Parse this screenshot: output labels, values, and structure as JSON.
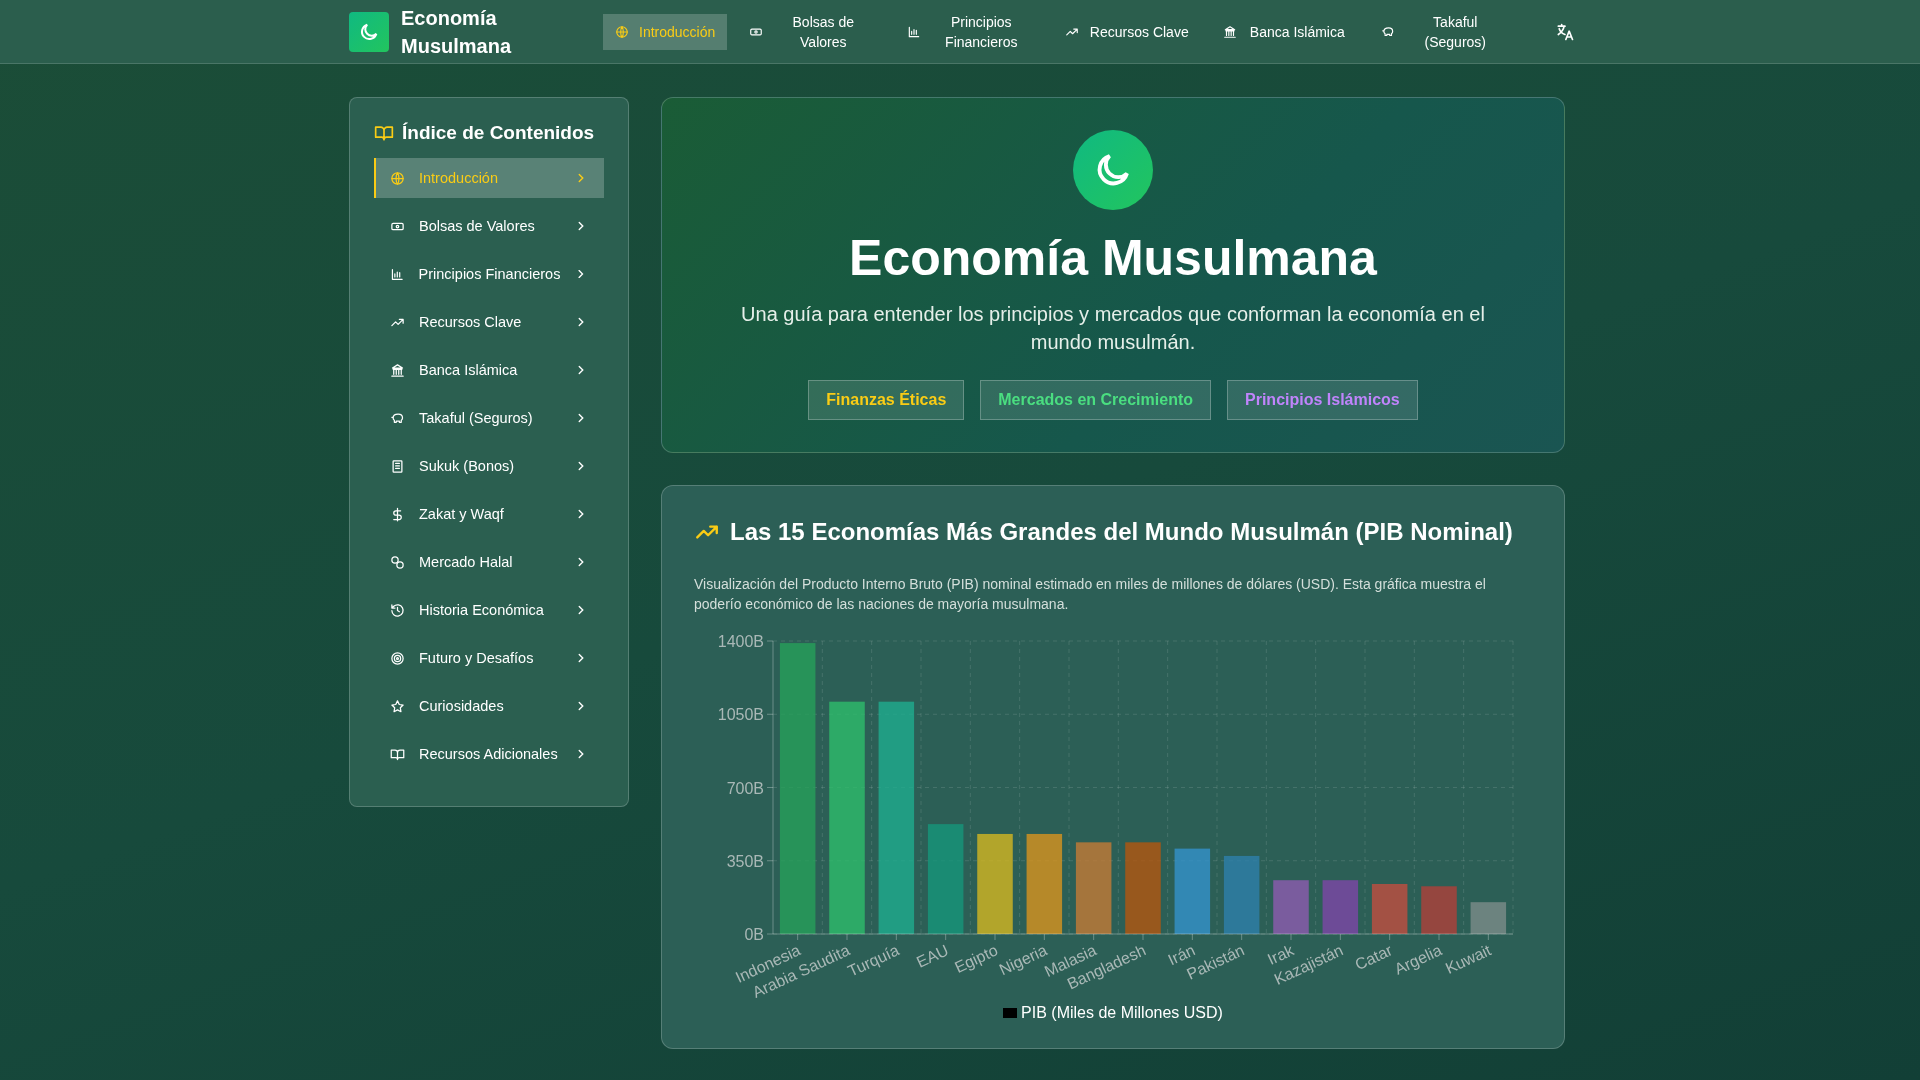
{
  "header": {
    "title": "Economía Musulmana",
    "nav": [
      {
        "label": "Introducción",
        "selected": true
      },
      {
        "label": "Bolsas de Valores",
        "selected": false
      },
      {
        "label": "Principios Financieros",
        "selected": false
      },
      {
        "label": "Recursos Clave",
        "selected": false
      },
      {
        "label": "Banca Islámica",
        "selected": false
      },
      {
        "label": "Takaful (Seguros)",
        "selected": false
      }
    ]
  },
  "sidebar": {
    "title": "Índice de Contenidos",
    "items": [
      {
        "label": "Introducción",
        "selected": true
      },
      {
        "label": "Bolsas de Valores",
        "selected": false
      },
      {
        "label": "Principios Financieros",
        "selected": false
      },
      {
        "label": "Recursos Clave",
        "selected": false
      },
      {
        "label": "Banca Islámica",
        "selected": false
      },
      {
        "label": "Takaful (Seguros)",
        "selected": false
      },
      {
        "label": "Sukuk (Bonos)",
        "selected": false
      },
      {
        "label": "Zakat y Waqf",
        "selected": false
      },
      {
        "label": "Mercado Halal",
        "selected": false
      },
      {
        "label": "Historia Económica",
        "selected": false
      },
      {
        "label": "Futuro y Desafíos",
        "selected": false
      },
      {
        "label": "Curiosidades",
        "selected": false
      },
      {
        "label": "Recursos Adicionales",
        "selected": false
      }
    ]
  },
  "hero": {
    "title": "Economía Musulmana",
    "subtitle": "Una guía para entender los principios y mercados que conforman la economía en el mundo musulmán.",
    "tags": [
      {
        "label": "Finanzas Éticas",
        "color": "#facc15"
      },
      {
        "label": "Mercados en Crecimiento",
        "color": "#4ade80"
      },
      {
        "label": "Principios Islámicos",
        "color": "#c084fc"
      }
    ]
  },
  "gdp_section": {
    "title": "Las 15 Economías Más Grandes del Mundo Musulmán (PIB Nominal)",
    "description": "Visualización del Producto Interno Bruto (PIB) nominal estimado en miles de millones de dólares (USD). Esta gráfica muestra el poderío económico de las naciones de mayoría musulmana.",
    "chart_data": {
      "type": "bar",
      "categories": [
        "Indonesia",
        "Arabia Saudita",
        "Turquía",
        "EAU",
        "Egipto",
        "Nigeria",
        "Malasia",
        "Bangladesh",
        "Irán",
        "Pakistán",
        "Irak",
        "Kazajistán",
        "Catar",
        "Argelia",
        "Kuwait"
      ],
      "series": [
        {
          "name": "PIB (Miles de Millones USD)",
          "color": "#000000",
          "values": [
            1390,
            1110,
            1110,
            525,
            478,
            478,
            438,
            438,
            408,
            373,
            257,
            257,
            239,
            228,
            152
          ],
          "colors": [
            "#27a05a",
            "#2ebd6b",
            "#1fac8e",
            "#16967a",
            "#d4b620",
            "#d9941e",
            "#c47a36",
            "#b4560f",
            "#3592cc",
            "#2e7fab",
            "#8e5bb0",
            "#7e46a8",
            "#c24e40",
            "#b0403a",
            "#7d8c8a"
          ]
        }
      ],
      "ylim": [
        0,
        1400
      ],
      "grid": true,
      "yticks": [
        {
          "value": 0,
          "label": "0B"
        },
        {
          "value": 350,
          "label": "350B"
        },
        {
          "value": 700,
          "label": "700B"
        },
        {
          "value": 1050,
          "label": "1050B"
        },
        {
          "value": 1400,
          "label": "1400B"
        }
      ]
    }
  }
}
